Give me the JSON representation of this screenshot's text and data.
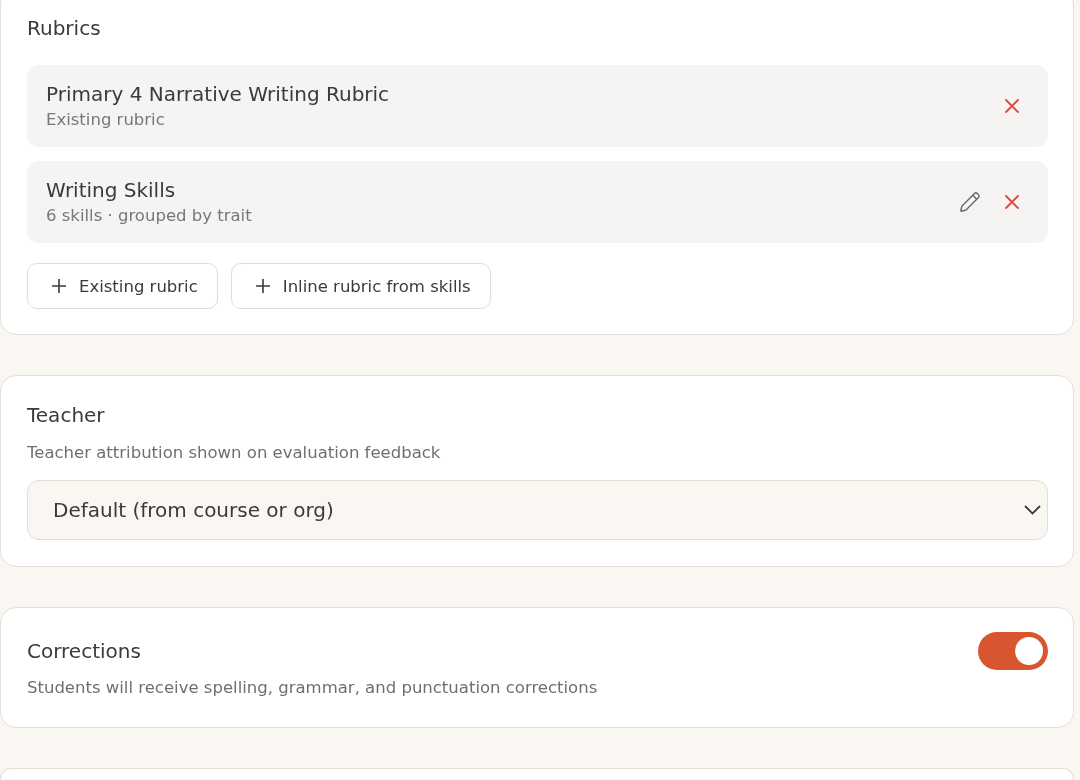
{
  "rubrics": {
    "title": "Rubrics",
    "items": [
      {
        "title": "Primary 4 Narrative Writing Rubric",
        "subtitle": "Existing rubric",
        "editable": false
      },
      {
        "title": "Writing Skills",
        "subtitle": "6 skills · grouped by trait",
        "editable": true
      }
    ],
    "add_buttons": [
      "Existing rubric",
      "Inline rubric from skills"
    ]
  },
  "teacher": {
    "title": "Teacher",
    "description": "Teacher attribution shown on evaluation feedback",
    "select": {
      "value": "Default (from course or org)"
    }
  },
  "corrections": {
    "title": "Corrections",
    "description": "Students will receive spelling, grammar, and punctuation corrections",
    "toggle": {
      "on": true
    }
  }
}
